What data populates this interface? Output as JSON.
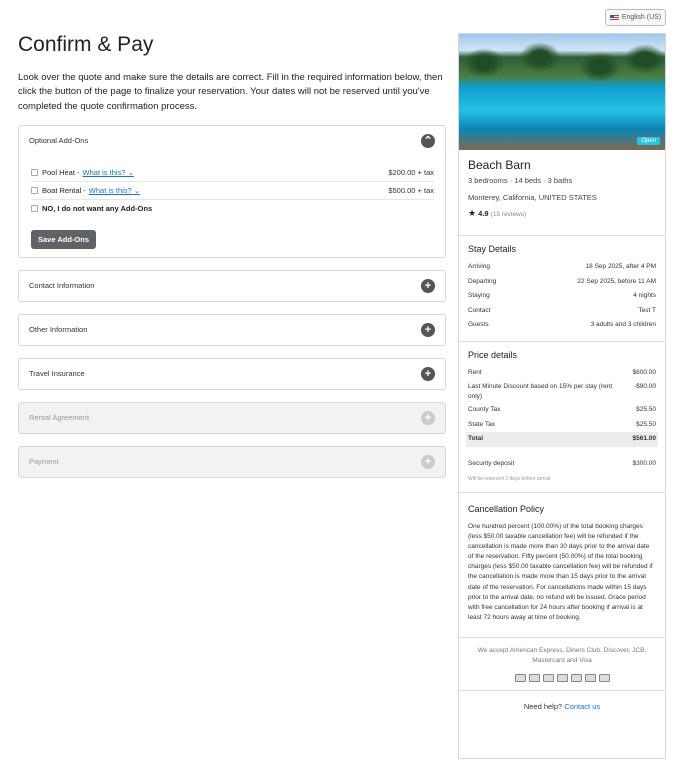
{
  "language": {
    "label": "English (US)"
  },
  "page": {
    "title": "Confirm & Pay",
    "intro": "Look over the quote and make sure the details are correct. Fill in the required information below, then click the button of the page to finalize your reservation. Your dates will not be reserved until you've completed the quote confirmation process."
  },
  "addons": {
    "title": "Optional Add-Ons",
    "items": [
      {
        "label": "Pool Heat -",
        "link": "What is this?",
        "price": "$200.00 + tax"
      },
      {
        "label": "Boat Rental -",
        "link": "What is this?",
        "price": "$500.00 + tax"
      }
    ],
    "none_label": "NO, I do not want any Add-Ons",
    "save_label": "Save Add-Ons"
  },
  "sections": [
    {
      "label": "Contact Information",
      "enabled": true
    },
    {
      "label": "Other Information",
      "enabled": true
    },
    {
      "label": "Travel Insurance",
      "enabled": true
    },
    {
      "label": "Rental Agreement",
      "enabled": false
    },
    {
      "label": "Payment",
      "enabled": false
    }
  ],
  "property": {
    "badge": "Open",
    "name": "Beach Barn",
    "meta": "3 bedrooms · 14 beds · 3 baths",
    "location": "Monterey, California, UNITED STATES",
    "rating": "4.9",
    "reviews": "(15 reviews)"
  },
  "stay": {
    "title": "Stay Details",
    "rows": [
      {
        "k": "Arriving",
        "v": "18 Sep 2025, after 4 PM"
      },
      {
        "k": "Departing",
        "v": "22 Sep 2025, before 11 AM"
      },
      {
        "k": "Staying",
        "v": "4 nights"
      },
      {
        "k": "Contact",
        "v": "Test T"
      },
      {
        "k": "Guests",
        "v": "3 adults and 3 children"
      }
    ]
  },
  "price": {
    "title": "Price details",
    "rows": [
      {
        "k": "Rent",
        "v": "$600.00"
      },
      {
        "k": "Last Minute Discount based on 15% per stay (rent only)",
        "v": "-$90.00"
      },
      {
        "k": "County Tax",
        "v": "$25.50"
      },
      {
        "k": "State Tax",
        "v": "$25.50"
      }
    ],
    "total_label": "Total",
    "total_value": "$561.00",
    "deposit_label": "Security deposit",
    "deposit_value": "$300.00",
    "deposit_note": "Will be reserved 2 days before arrival"
  },
  "cancellation": {
    "title": "Cancellation Policy",
    "text": "One hundred percent (100.00%) of the total booking charges (less $50.00 taxable cancellation fee) will be refunded if the cancellation is made more than 30 days prior to the arrival date of the reservation. Fifty percent (50.00%) of the total booking charges (less $50.00 taxable cancellation fee) will be refunded if the cancellation is made more than 15 days prior to the arrival date of the reservation. For cancellations made within 15 days prior to the arrival date, no refund will be issued. Grace period with free cancellation for 24 hours after booking if arrival is at least 72 hours away at time of booking."
  },
  "payment_methods": {
    "text": "We accept American Express, Diners Club, Discover, JCB, Mastercard and Visa",
    "icons": [
      "amex-icon",
      "diners-icon",
      "discover-icon",
      "jcb-icon",
      "generic-card-icon",
      "mastercard-icon",
      "visa-icon"
    ]
  },
  "help": {
    "text": "Need help?",
    "link": "Contact us"
  }
}
